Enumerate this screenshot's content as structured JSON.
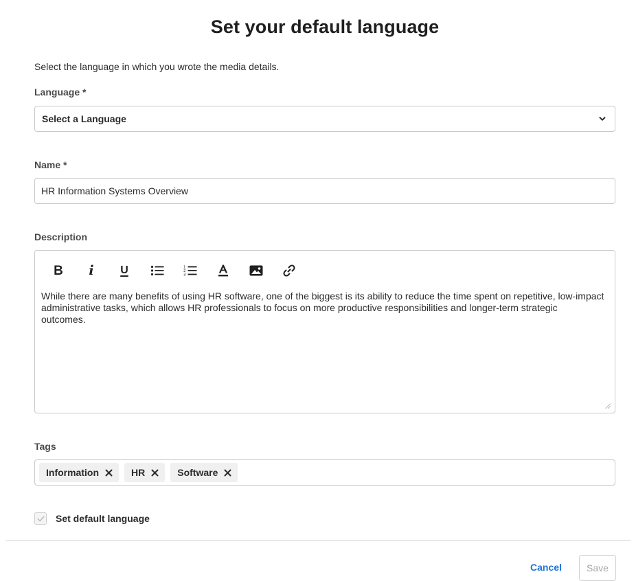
{
  "dialog": {
    "title": "Set your default language",
    "intro": "Select the language in which you wrote the media details."
  },
  "language": {
    "label": "Language *",
    "selected": "Select a Language"
  },
  "name": {
    "label": "Name *",
    "value": "HR Information Systems Overview"
  },
  "description": {
    "label": "Description",
    "toolbar": {
      "bold": "B",
      "italic": "i",
      "underline": "U",
      "bullet_list_icon": "bullet-list-icon",
      "numbered_list_icon": "numbered-list-icon",
      "text_color_icon": "text-color-icon",
      "image_icon": "image-icon",
      "link_icon": "link-icon"
    },
    "text": "While there are many benefits of using HR software, one of the biggest is its ability to reduce the time spent on repetitive, low-impact administrative tasks, which allows HR professionals to focus on more productive responsibilities and longer-term strategic outcomes."
  },
  "tags": {
    "label": "Tags",
    "items": [
      {
        "label": "Information"
      },
      {
        "label": "HR"
      },
      {
        "label": "Software"
      }
    ]
  },
  "default_language": {
    "label": "Set default language",
    "checked": true
  },
  "footer": {
    "cancel_label": "Cancel",
    "save_label": "Save"
  },
  "colors": {
    "accent": "#1e73d8",
    "border": "#c9c9c9",
    "tag_bg": "#f0f0f0",
    "disabled_text": "#a8a8a8"
  }
}
